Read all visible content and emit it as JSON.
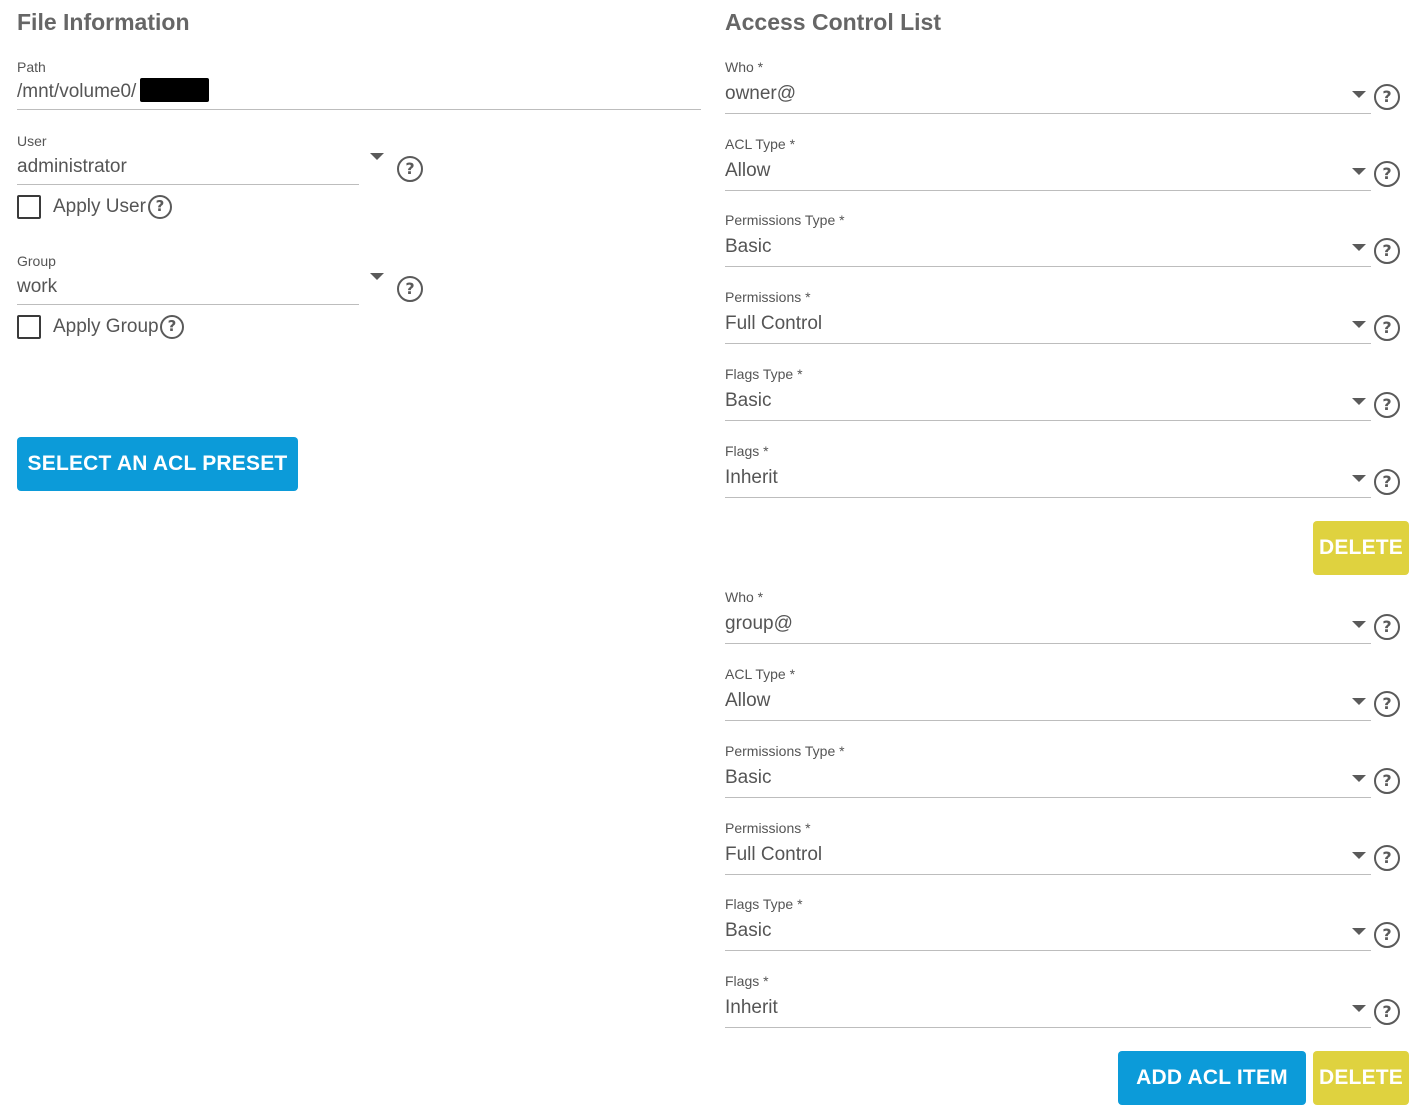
{
  "file_info": {
    "title": "File Information",
    "path": {
      "label": "Path",
      "value": "/mnt/volume0/"
    },
    "user": {
      "label": "User",
      "value": "administrator",
      "apply_label": "Apply User"
    },
    "group": {
      "label": "Group",
      "value": "work",
      "apply_label": "Apply Group"
    },
    "preset_button": "SELECT AN ACL PRESET"
  },
  "acl": {
    "title": "Access Control List",
    "items": [
      {
        "who": {
          "label": "Who *",
          "value": "owner@"
        },
        "acl_type": {
          "label": "ACL Type *",
          "value": "Allow"
        },
        "permissions_type": {
          "label": "Permissions Type *",
          "value": "Basic"
        },
        "permissions": {
          "label": "Permissions *",
          "value": "Full Control"
        },
        "flags_type": {
          "label": "Flags Type *",
          "value": "Basic"
        },
        "flags": {
          "label": "Flags *",
          "value": "Inherit"
        },
        "delete_label": "DELETE"
      },
      {
        "who": {
          "label": "Who *",
          "value": "group@"
        },
        "acl_type": {
          "label": "ACL Type *",
          "value": "Allow"
        },
        "permissions_type": {
          "label": "Permissions Type *",
          "value": "Basic"
        },
        "permissions": {
          "label": "Permissions *",
          "value": "Full Control"
        },
        "flags_type": {
          "label": "Flags Type *",
          "value": "Basic"
        },
        "flags": {
          "label": "Flags *",
          "value": "Inherit"
        },
        "delete_label": "DELETE"
      }
    ],
    "add_button": "ADD ACL ITEM"
  },
  "icons": {
    "help": "help-circle-icon",
    "dropdown": "chevron-down-icon",
    "checkbox": "checkbox-unchecked-icon"
  },
  "colors": {
    "primary": "#0c9bd9",
    "warning": "#dfd23f",
    "text": "#555555",
    "underline": "#bdbdbd"
  }
}
